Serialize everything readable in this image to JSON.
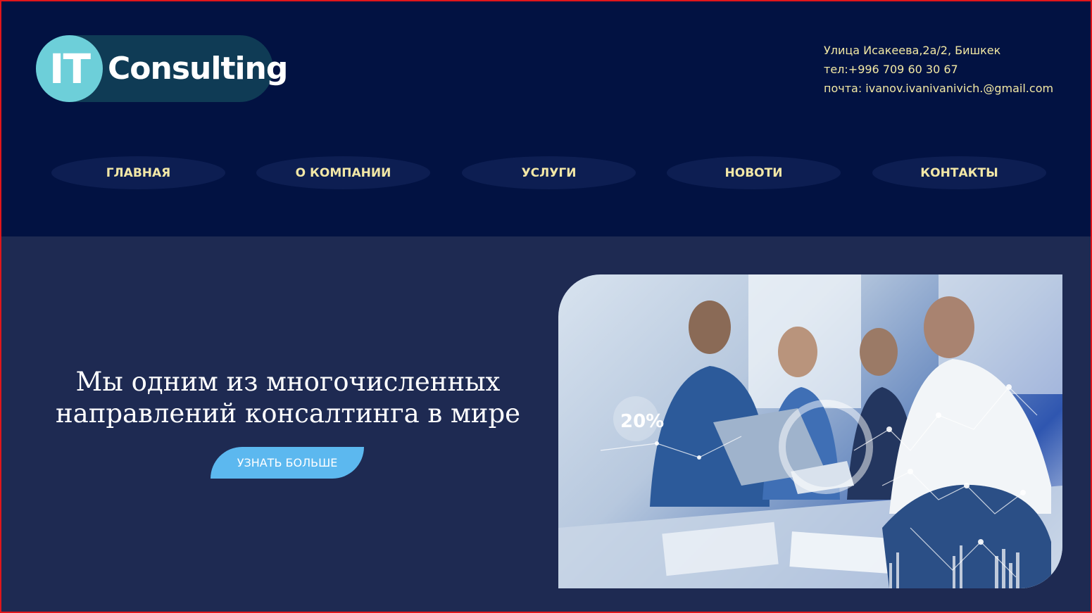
{
  "logo": {
    "badge": "IT",
    "text": "Consulting"
  },
  "contacts": {
    "address": "Улица Исакеева,2а/2, Бишкек",
    "phone": "тел:+996 709 60 30 67",
    "email": "почта: ivanov.ivanivanivich.@gmail.com"
  },
  "nav": {
    "items": [
      {
        "label": "ГЛАВНАЯ"
      },
      {
        "label": "О КОМПАНИИ"
      },
      {
        "label": "УСЛУГИ"
      },
      {
        "label": "НОВОТИ"
      },
      {
        "label": "КОНТАКТЫ"
      }
    ]
  },
  "hero": {
    "title_line1": "Мы одним из многочисленных",
    "title_line2": "направлений консалтинга в мире",
    "cta_label": "УЗНАТЬ БОЛЬШЕ",
    "photo_overlay_text": "20%"
  },
  "colors": {
    "header_bg": "#021242",
    "hero_bg": "#1e2a52",
    "nav_text": "#f2e7a6",
    "contact_text": "#f3e9a4",
    "cta_bg": "#5cb8ef",
    "logo_accent": "#6dcfd9"
  }
}
